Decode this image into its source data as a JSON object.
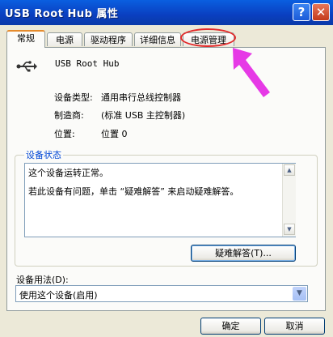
{
  "window": {
    "title": "USB Root Hub 属性",
    "help_glyph": "?",
    "close_glyph": "✕"
  },
  "tabs": [
    {
      "label": "常规"
    },
    {
      "label": "电源"
    },
    {
      "label": "驱动程序"
    },
    {
      "label": "详细信息"
    },
    {
      "label": "电源管理"
    }
  ],
  "general": {
    "device_icon": "usb-icon",
    "device_name": "USB Root Hub",
    "device_type_label": "设备类型:",
    "device_type_value": "通用串行总线控制器",
    "manufacturer_label": "制造商:",
    "manufacturer_value": "(标准 USB 主控制器)",
    "location_label": "位置:",
    "location_value": "位置 0",
    "status_group_label": "设备状态",
    "status_lines": [
      "这个设备运转正常。",
      "若此设备有问题，单击 “疑难解答” 来启动疑难解答。"
    ],
    "troubleshoot_button": "疑难解答(T)...",
    "usage_label": "设备用法(D):",
    "usage_value": "使用这个设备(启用)"
  },
  "buttons": {
    "ok": "确定",
    "cancel": "取消"
  },
  "annotation": {
    "highlight_color": "#e32a2a",
    "arrow_color": "#e639e6"
  },
  "colors": {
    "titlebar": "#0a50d8",
    "dialog_bg": "#ece9d8",
    "group_label": "#0046d5"
  }
}
